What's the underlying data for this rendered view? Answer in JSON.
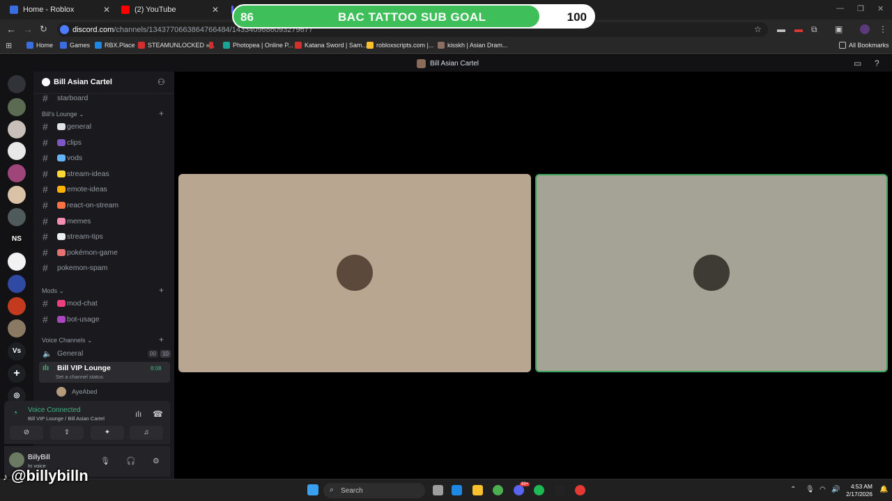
{
  "browser": {
    "tabs": [
      {
        "title": "Home - Roblox",
        "color": "#3a6de0"
      },
      {
        "title": "(2) YouTube",
        "color": "#ff0000"
      },
      {
        "title": "",
        "color": "#5865f2"
      }
    ],
    "url_domain": "discord.com",
    "url_path": "/channels/1343770663864766484/1433409686093279677",
    "bookmarks": [
      {
        "label": "Home",
        "color": "#3a6de0"
      },
      {
        "label": "Games",
        "color": "#3a6de0"
      },
      {
        "label": "RBX.Place",
        "color": "#1e88e5"
      },
      {
        "label": "STEAMUNLOCKED »...",
        "color": "#d32f2f"
      },
      {
        "label": "",
        "color": "#d32f2f"
      },
      {
        "label": "Photopea | Online P...",
        "color": "#18a497"
      },
      {
        "label": "Katana Sword | Sam...",
        "color": "#d32f2f"
      },
      {
        "label": "robloxscripts.com |...",
        "color": "#fbc02d"
      },
      {
        "label": "kisskh | Asian Dram...",
        "color": "#8d6e63"
      }
    ],
    "all_bookmarks": "All Bookmarks"
  },
  "goal": {
    "start": "86",
    "label": "BAC TATTOO SUB GOAL",
    "end": "100",
    "progress": 0.86,
    "fill_color": "#3fbf5a"
  },
  "discord": {
    "window_title": "Bill Asian Cartel",
    "server_name": "Bill Asian Cartel",
    "partial_channel": "starboard",
    "categories": [
      {
        "label": "Bill's Lounge"
      },
      {
        "label": "Mods"
      },
      {
        "label": "Voice Channels"
      }
    ],
    "lounge_channels": [
      {
        "name": "general",
        "emoji": "#dfe3e8"
      },
      {
        "name": "clips",
        "emoji": "#7e57c2"
      },
      {
        "name": "vods",
        "emoji": "#64b5f6"
      },
      {
        "name": "stream-ideas",
        "emoji": "#fdd835"
      },
      {
        "name": "emote-ideas",
        "emoji": "#ffb300"
      },
      {
        "name": "react-on-stream",
        "emoji": "#ff7043"
      },
      {
        "name": "memes",
        "emoji": "#f48fb1"
      },
      {
        "name": "stream-tips",
        "emoji": "#eceff1"
      },
      {
        "name": "pokémon-game",
        "emoji": "#e57373"
      },
      {
        "name": "pokemon-spam",
        "emoji": ""
      }
    ],
    "mod_channels": [
      {
        "name": "mod-chat",
        "emoji": "#ec407a"
      },
      {
        "name": "bot-usage",
        "emoji": "#ab47bc"
      }
    ],
    "voice_general": {
      "name": "General",
      "count_a": "00",
      "count_b": "10"
    },
    "voice_active": {
      "name": "Bill VIP Lounge",
      "timer": "8:08",
      "status": "Set a channel status"
    },
    "voice_member": "AyeAbed",
    "voice_panel": {
      "state": "Voice Connected",
      "location": "Bill VIP Lounge / Bill Asian Cartel"
    },
    "user": {
      "name": "BillyBill",
      "status": "In voice"
    }
  },
  "stage": {
    "tile1_bg": "#b8a690",
    "tile2_bg": "#a4a395",
    "speaking_border": "#3ba55d"
  },
  "taskbar": {
    "search_placeholder": "Search",
    "time": "4:53 AM",
    "date": "2/17/2026",
    "badge_count": "99+"
  },
  "watermark": "@billybilln"
}
